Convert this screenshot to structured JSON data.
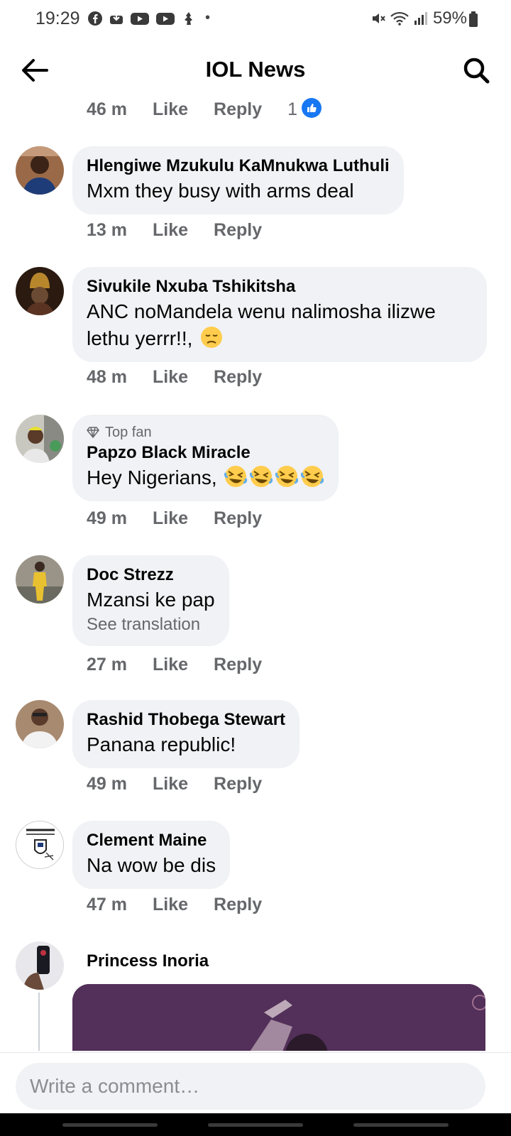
{
  "status_bar": {
    "time": "19:29",
    "battery": "59%",
    "left_icons": [
      "facebook-icon",
      "download-icon",
      "youtube-icon",
      "youtube-icon",
      "notification-icon"
    ],
    "right_icons": [
      "mute-icon",
      "wifi-icon",
      "signal-icon",
      "battery-icon"
    ]
  },
  "header": {
    "title": "IOL News"
  },
  "top_meta": {
    "time": "46 m",
    "like": "Like",
    "reply": "Reply",
    "reaction_count": "1"
  },
  "comments": [
    {
      "author": "Hlengiwe Mzukulu KaMnukwa Luthuli",
      "text": "Mxm  they busy  with arms deal",
      "time": "13 m",
      "like": "Like",
      "reply": "Reply"
    },
    {
      "author": "Sivukile Nxuba Tshikitsha",
      "text_line1": "ANC noMandela wenu nalimosha ilizwe",
      "text_line2": "lethu yerrr!!, ",
      "time": "48 m",
      "like": "Like",
      "reply": "Reply"
    },
    {
      "badge": "Top fan",
      "author": "Papzo Black Miracle",
      "text": "Hey Nigerians, ",
      "time": "49 m",
      "like": "Like",
      "reply": "Reply"
    },
    {
      "author": "Doc Strezz",
      "text": "Mzansi ke pap",
      "translate": "See translation",
      "time": "27 m",
      "like": "Like",
      "reply": "Reply"
    },
    {
      "author": "Rashid Thobega Stewart",
      "text": "Panana republic!",
      "time": "49 m",
      "like": "Like",
      "reply": "Reply"
    },
    {
      "author": "Clement Maine",
      "text": "Na wow be dis",
      "time": "47 m",
      "like": "Like",
      "reply": "Reply"
    },
    {
      "author": "Princess Inoria"
    }
  ],
  "composer": {
    "placeholder": "Write a comment…"
  },
  "colors": {
    "bubble": "#f0f2f5",
    "meta_text": "#65676b",
    "like_blue": "#1877f2"
  }
}
